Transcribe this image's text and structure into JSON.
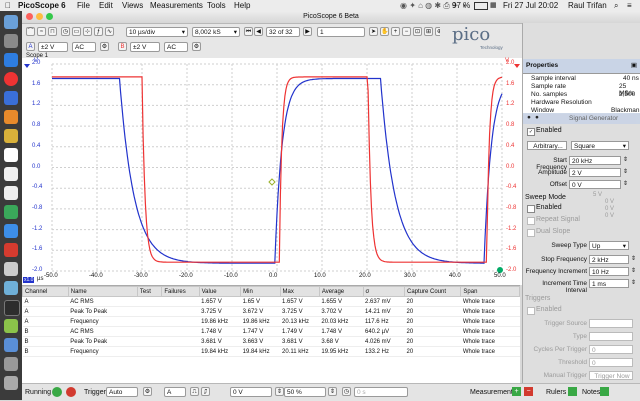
{
  "menubar": {
    "app": "PicoScope 6",
    "items": [
      "File",
      "Edit",
      "Views",
      "Measurements",
      "Tools",
      "Help"
    ],
    "battery": "97 %",
    "datetime": "Fri 27 Jul  20:02",
    "user": "Raul Trifan"
  },
  "window": {
    "title": "PicoScope 6 Beta"
  },
  "toolbar1": {
    "timebase": "10 µs/div",
    "samples": "8,002 kS",
    "buffer": "32 of 32",
    "capture_count": "1",
    "logo": "pico",
    "logo_sub": "Technology"
  },
  "toolbar2": {
    "chA": {
      "label": "A",
      "range": "±2 V",
      "coupling": "AC"
    },
    "chB": {
      "label": "B",
      "range": "±2 V",
      "coupling": "AC"
    }
  },
  "scope": {
    "tab": "Scope 1",
    "y_unit_left": "V",
    "y_unit_right": "V",
    "y_ticks": [
      "2.0",
      "1.6",
      "1.2",
      "0.8",
      "0.4",
      "0.0",
      "-0.4",
      "-0.8",
      "-1.2",
      "-1.6",
      "-2.0"
    ],
    "x_ticks": [
      "-50.0",
      "-40.0",
      "-30.0",
      "-20.0",
      "-10.0",
      "0.0",
      "10.0",
      "20.0",
      "30.0",
      "40.0",
      "50.0"
    ],
    "x_unit": "µs",
    "x_unit_marker": "x1.0",
    "colors": {
      "chA": "#2233cc",
      "chB": "#ee3333"
    }
  },
  "measurements": {
    "headers": [
      "Channel",
      "Name",
      "Test",
      "Failures",
      "Value",
      "Min",
      "Max",
      "Average",
      "σ",
      "Capture Count",
      "Span"
    ],
    "rows": [
      [
        "A",
        "AC RMS",
        "",
        "",
        "1.657 V",
        "1.65 V",
        "1.657 V",
        "1.655 V",
        "2.637 mV",
        "20",
        "Whole trace"
      ],
      [
        "A",
        "Peak To Peak",
        "",
        "",
        "3.725 V",
        "3.672 V",
        "3.725 V",
        "3.702 V",
        "14.21 mV",
        "20",
        "Whole trace"
      ],
      [
        "A",
        "Frequency",
        "",
        "",
        "19.86 kHz",
        "19.86 kHz",
        "20.13 kHz",
        "20.03 kHz",
        "117.6 Hz",
        "20",
        "Whole trace"
      ],
      [
        "B",
        "AC RMS",
        "",
        "",
        "1.748 V",
        "1.747 V",
        "1.749 V",
        "1.748 V",
        "640.2 µV",
        "20",
        "Whole trace"
      ],
      [
        "B",
        "Peak To Peak",
        "",
        "",
        "3.681 V",
        "3.663 V",
        "3.681 V",
        "3.68 V",
        "4.026 mV",
        "20",
        "Whole trace"
      ],
      [
        "B",
        "Frequency",
        "",
        "",
        "19.84 kHz",
        "19.84 kHz",
        "20.11 kHz",
        "19.95 kHz",
        "133.2 Hz",
        "20",
        "Whole trace"
      ]
    ]
  },
  "properties": {
    "title": "Properties",
    "rows": [
      {
        "label": "Sample interval",
        "value": "40 ns"
      },
      {
        "label": "Sample rate",
        "value": "25 MS/s"
      },
      {
        "label": "No. samples",
        "value": "2,500"
      },
      {
        "label": "Hardware Resolution",
        "value": ""
      },
      {
        "label": "Window",
        "value": "Blackman"
      }
    ]
  },
  "siggen": {
    "title": "Signal Generator",
    "enabled_label": "Enabled",
    "arbitrary_label": "Arbitrary...",
    "waveform": "Square",
    "start_freq_label": "Start Frequency",
    "start_freq": "20 kHz",
    "amplitude_label": "Amplitude",
    "amplitude": "2 V",
    "offset_label": "Offset",
    "offset": "0 V",
    "bg_labels": [
      "5 V",
      "0 V",
      "0 V",
      "0 V"
    ],
    "sweep_mode_label": "Sweep Mode",
    "sweep_enabled_label": "Enabled",
    "repeat_signal_label": "Repeat Signal",
    "dual_slope_label": "Dual Slope",
    "sweep_type_label": "Sweep Type",
    "sweep_type": "Up",
    "stop_freq_label": "Stop Frequency",
    "stop_freq": "2 kHz",
    "freq_incr_label": "Frequency Increment",
    "freq_incr": "10 Hz",
    "incr_time_label": "Increment Time Interval",
    "incr_time": "1 ms",
    "triggers_label": "Triggers",
    "trig_enabled_label": "Enabled",
    "trig_source_label": "Trigger Source",
    "trig_type_label": "Type",
    "cycles_label": "Cycles Per Trigger",
    "cycles": "0",
    "threshold_label": "Threshold",
    "threshold": "0",
    "manual_label": "Manual Trigger",
    "trigger_now": "Trigger Now"
  },
  "statusbar": {
    "running": "Running",
    "trigger_label": "Trigger",
    "trigger_mode": "Auto",
    "trigger_channel": "A",
    "trigger_level": "0 V",
    "trigger_pos": "50 %",
    "trigger_delay": "0 s",
    "measurements": "Measurements",
    "rulers": "Rulers",
    "notes": "Notes"
  }
}
